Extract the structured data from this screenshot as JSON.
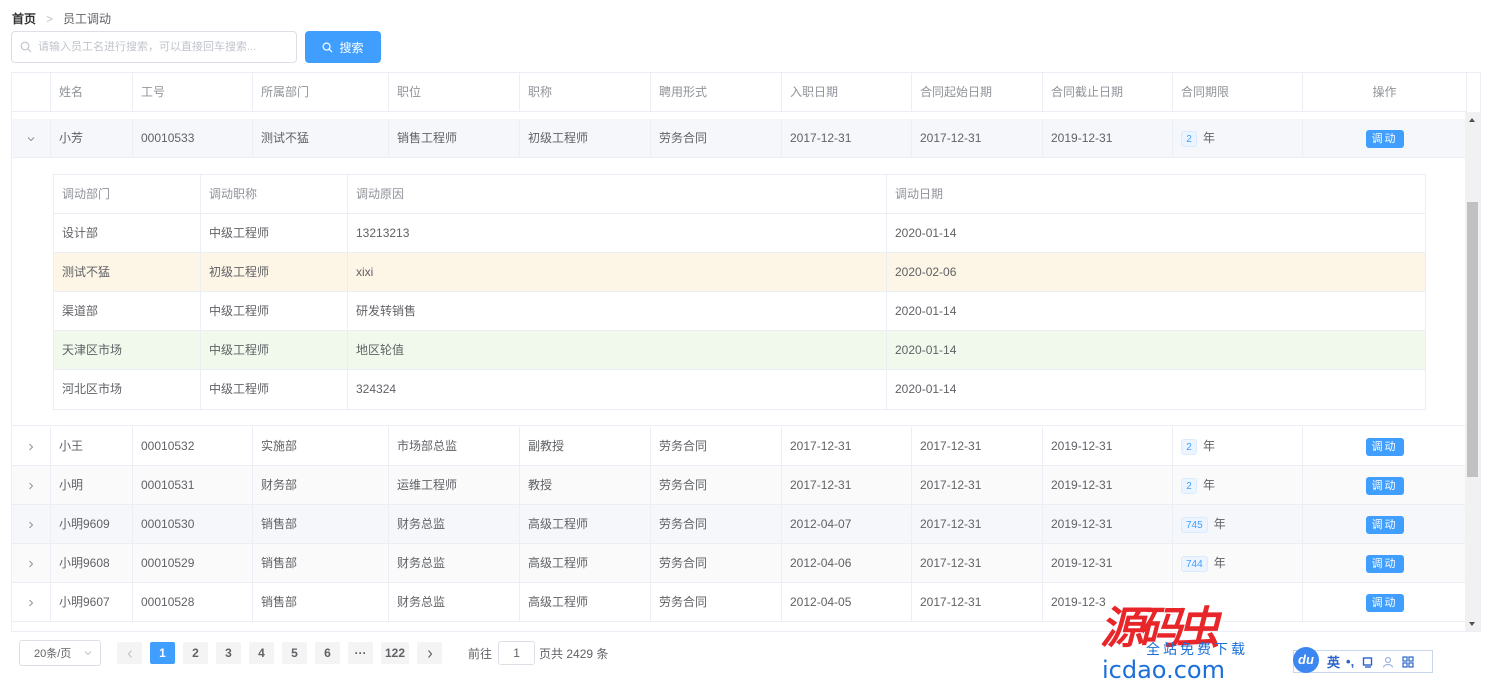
{
  "breadcrumb": {
    "home": "首页",
    "separator": ">",
    "current": "员工调动"
  },
  "search": {
    "placeholder": "请输入员工名进行搜索，可以直接回车搜索...",
    "button_label": "搜索"
  },
  "table": {
    "columns": [
      "姓名",
      "工号",
      "所属部门",
      "职位",
      "职称",
      "聘用形式",
      "入职日期",
      "合同起始日期",
      "合同截止日期",
      "合同期限",
      "操作"
    ],
    "year_unit": "年",
    "action_label": "调动",
    "rows": [
      {
        "name": "小芳",
        "id": "00010533",
        "dept": "测试不猛",
        "position": "销售工程师",
        "title": "初级工程师",
        "employ": "劳务合同",
        "join": "2017-12-31",
        "start": "2017-12-31",
        "end": "2019-12-31",
        "term": "2"
      },
      {
        "name": "小王",
        "id": "00010532",
        "dept": "实施部",
        "position": "市场部总监",
        "title": "副教授",
        "employ": "劳务合同",
        "join": "2017-12-31",
        "start": "2017-12-31",
        "end": "2019-12-31",
        "term": "2"
      },
      {
        "name": "小明",
        "id": "00010531",
        "dept": "财务部",
        "position": "运维工程师",
        "title": "教授",
        "employ": "劳务合同",
        "join": "2017-12-31",
        "start": "2017-12-31",
        "end": "2019-12-31",
        "term": "2"
      },
      {
        "name": "小明9609",
        "id": "00010530",
        "dept": "销售部",
        "position": "财务总监",
        "title": "高级工程师",
        "employ": "劳务合同",
        "join": "2012-04-07",
        "start": "2017-12-31",
        "end": "2019-12-31",
        "term": "745"
      },
      {
        "name": "小明9608",
        "id": "00010529",
        "dept": "销售部",
        "position": "财务总监",
        "title": "高级工程师",
        "employ": "劳务合同",
        "join": "2012-04-06",
        "start": "2017-12-31",
        "end": "2019-12-31",
        "term": "744"
      },
      {
        "name": "小明9607",
        "id": "00010528",
        "dept": "销售部",
        "position": "财务总监",
        "title": "高级工程师",
        "employ": "劳务合同",
        "join": "2012-04-05",
        "start": "2017-12-31",
        "end": "2019-12-3",
        "term": ""
      }
    ],
    "expanded": {
      "columns": [
        "调动部门",
        "调动职称",
        "调动原因",
        "调动日期"
      ],
      "rows": [
        {
          "dept": "设计部",
          "title": "中级工程师",
          "reason": "13213213",
          "date": "2020-01-14"
        },
        {
          "dept": "测试不猛",
          "title": "初级工程师",
          "reason": "xixi",
          "date": "2020-02-06"
        },
        {
          "dept": "渠道部",
          "title": "中级工程师",
          "reason": "研发转销售",
          "date": "2020-01-14"
        },
        {
          "dept": "天津区市场",
          "title": "中级工程师",
          "reason": "地区轮值",
          "date": "2020-01-14"
        },
        {
          "dept": "河北区市场",
          "title": "中级工程师",
          "reason": "324324",
          "date": "2020-01-14"
        }
      ]
    }
  },
  "pagination": {
    "page_size": "20条/页",
    "pages": [
      "1",
      "2",
      "3",
      "4",
      "5",
      "6",
      "···",
      "122"
    ],
    "current_page": "1",
    "goto_prefix": "前往",
    "goto_value": "1",
    "total_text": "页共 2429 条"
  },
  "watermark": {
    "sub": "全站免费下载",
    "site": "icdao.com"
  },
  "ime": {
    "logo": "du",
    "lang": "英",
    "punct": "•,"
  },
  "colors": {
    "primary": "#409eff",
    "warning_row": "#fdf5e6",
    "success_row": "#f0f9eb",
    "border": "#ebeef5"
  }
}
